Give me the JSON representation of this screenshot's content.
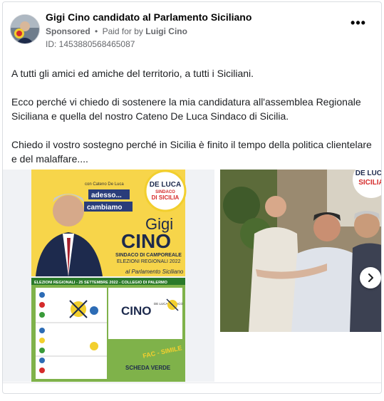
{
  "ad": {
    "page_name": "Gigi Cino candidato al Parlamento Siciliano",
    "sponsored_label": "Sponsored",
    "separator": "•",
    "paid_for_label": "Paid for by",
    "payer_name": "Luigi Cino",
    "id_text": "ID: 1453880568465087",
    "more_label": "•••"
  },
  "body": {
    "paragraphs": [
      "A tutti gli amici ed amiche del territorio, a tutti i Siciliani.",
      "Ecco perché vi chiedo di sostenere la mia candidatura all'assemblea Regionale Siciliana e quella del nostro Cateno De Luca Sindaco di Sicilia.",
      "Chiedo il vostro sostegno perché in Sicilia è finito il tempo della politica clientelare e del malaffare...."
    ]
  },
  "poster": {
    "with_text": "con Cateno De Luca",
    "adesso_text": "adesso...",
    "cambiamo_text": "cambiamo",
    "badge_line1": "DE LUCA",
    "badge_line2": "SINDACO",
    "badge_line3": "DI SICILIA",
    "first_name": "Gigi",
    "last_name": "CINO",
    "role_line1": "SINDACO DI CAMPOREALE",
    "role_line2": "ELEZIONI REGIONALI 2022",
    "role_line3": "al Parlamento Siciliano",
    "ballot_header": "ELEZIONI REGIONALI - 25 SETTEMBRE 2022 - COLLEGIO DI PALERMO",
    "ballot_name": "CINO",
    "ballot_aside": "DE LUCA SINDACO",
    "fac_simile": "FAC - SIMILE",
    "scheda": "SCHEDA VERDE"
  },
  "photo": {
    "badge_line1": "DE LUCA",
    "badge_line2": "SICILIA"
  },
  "colors": {
    "poster_yellow": "#f7d54a",
    "ballot_green": "#7fb24a",
    "badge_red": "#d52b2b",
    "text_secondary": "#65676b"
  },
  "icons": {
    "more": "more-horizontal-icon",
    "next": "chevron-right-icon"
  }
}
